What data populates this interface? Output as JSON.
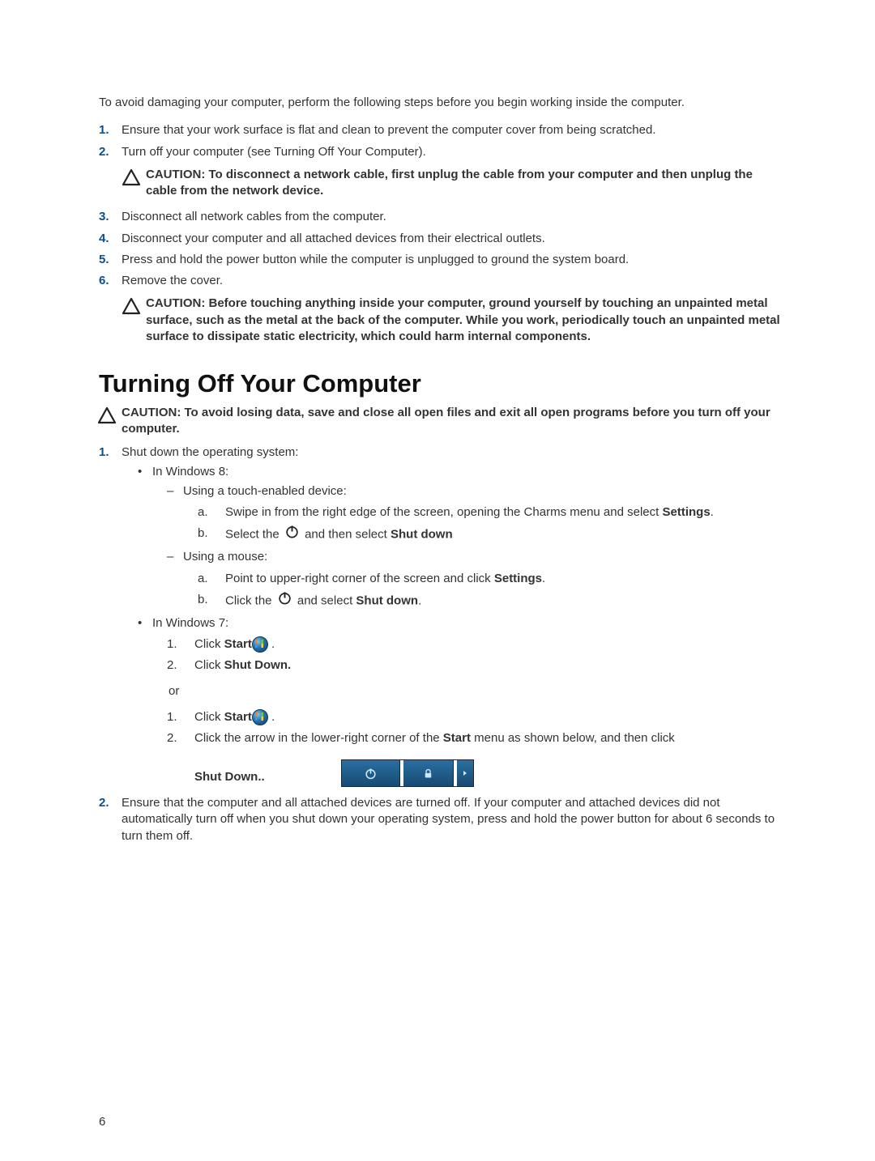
{
  "intro": "To avoid damaging your computer, perform the following steps before you begin working inside the computer.",
  "steps_top": {
    "1": "Ensure that your work surface is flat and clean to prevent the computer cover from being scratched.",
    "2": "Turn off your computer (see Turning Off Your Computer).",
    "3": "Disconnect all network cables from the computer.",
    "4": "Disconnect your computer and all attached devices from their electrical outlets.",
    "5": "Press and hold the power button while the computer is unplugged to ground the system board.",
    "6": "Remove the cover."
  },
  "caution1": "CAUTION: To disconnect a network cable, first unplug the cable from your computer and then unplug the cable from the network device.",
  "caution2": "CAUTION: Before touching anything inside your computer, ground yourself by touching an unpainted metal surface, such as the metal at the back of the computer. While you work, periodically touch an unpainted metal surface to dissipate static electricity, which could harm internal components.",
  "section_title": "Turning Off Your Computer",
  "caution3": "CAUTION: To avoid losing data, save and close all open files and exit all open programs before you turn off your computer.",
  "steps_bottom": {
    "1": "Shut down the operating system:",
    "2": "Ensure that the computer and all attached devices are turned off. If your computer and attached devices did not automatically turn off when you shut down your operating system, press and hold the power button for about 6 seconds to turn them off."
  },
  "win8_label": "In Windows 8:",
  "win8_touch_label": "Using a touch-enabled device:",
  "win8_touch_a_1": "Swipe in from the right edge of the screen, opening the Charms menu and select ",
  "win8_touch_a_2": "Settings",
  "win8_touch_a_3": ".",
  "win8_touch_b_1": "Select the ",
  "win8_touch_b_2": " and then select ",
  "win8_touch_b_3": "Shut down",
  "win8_mouse_label": "Using a mouse:",
  "win8_mouse_a_1": "Point to upper-right corner of the screen and click ",
  "win8_mouse_a_2": "Settings",
  "win8_mouse_a_3": ".",
  "win8_mouse_b_1": "Click the ",
  "win8_mouse_b_2": " and select ",
  "win8_mouse_b_3": "Shut down",
  "win8_mouse_b_4": ".",
  "win7_label": "In Windows 7:",
  "win7_1_1": "Click ",
  "win7_1_2": "Start",
  "win7_1_3": " .",
  "win7_2_1": "Click ",
  "win7_2_2": "Shut Down.",
  "or_text": "or",
  "win7b_1_1": "Click ",
  "win7b_1_2": "Start",
  "win7b_1_3": " .",
  "win7b_2_1": "Click the arrow in the lower-right corner of the ",
  "win7b_2_2": "Start",
  "win7b_2_3": " menu as shown below, and then click",
  "shutdown_label": "Shut Down.",
  "shutdown_label_suffix": ".",
  "page_number": "6",
  "markers": {
    "m1": "1.",
    "m2": "2.",
    "m3": "3.",
    "m4": "4.",
    "m5": "5.",
    "m6": "6.",
    "ma": "a.",
    "mb": "b.",
    "n1": "1.",
    "n2": "2."
  }
}
